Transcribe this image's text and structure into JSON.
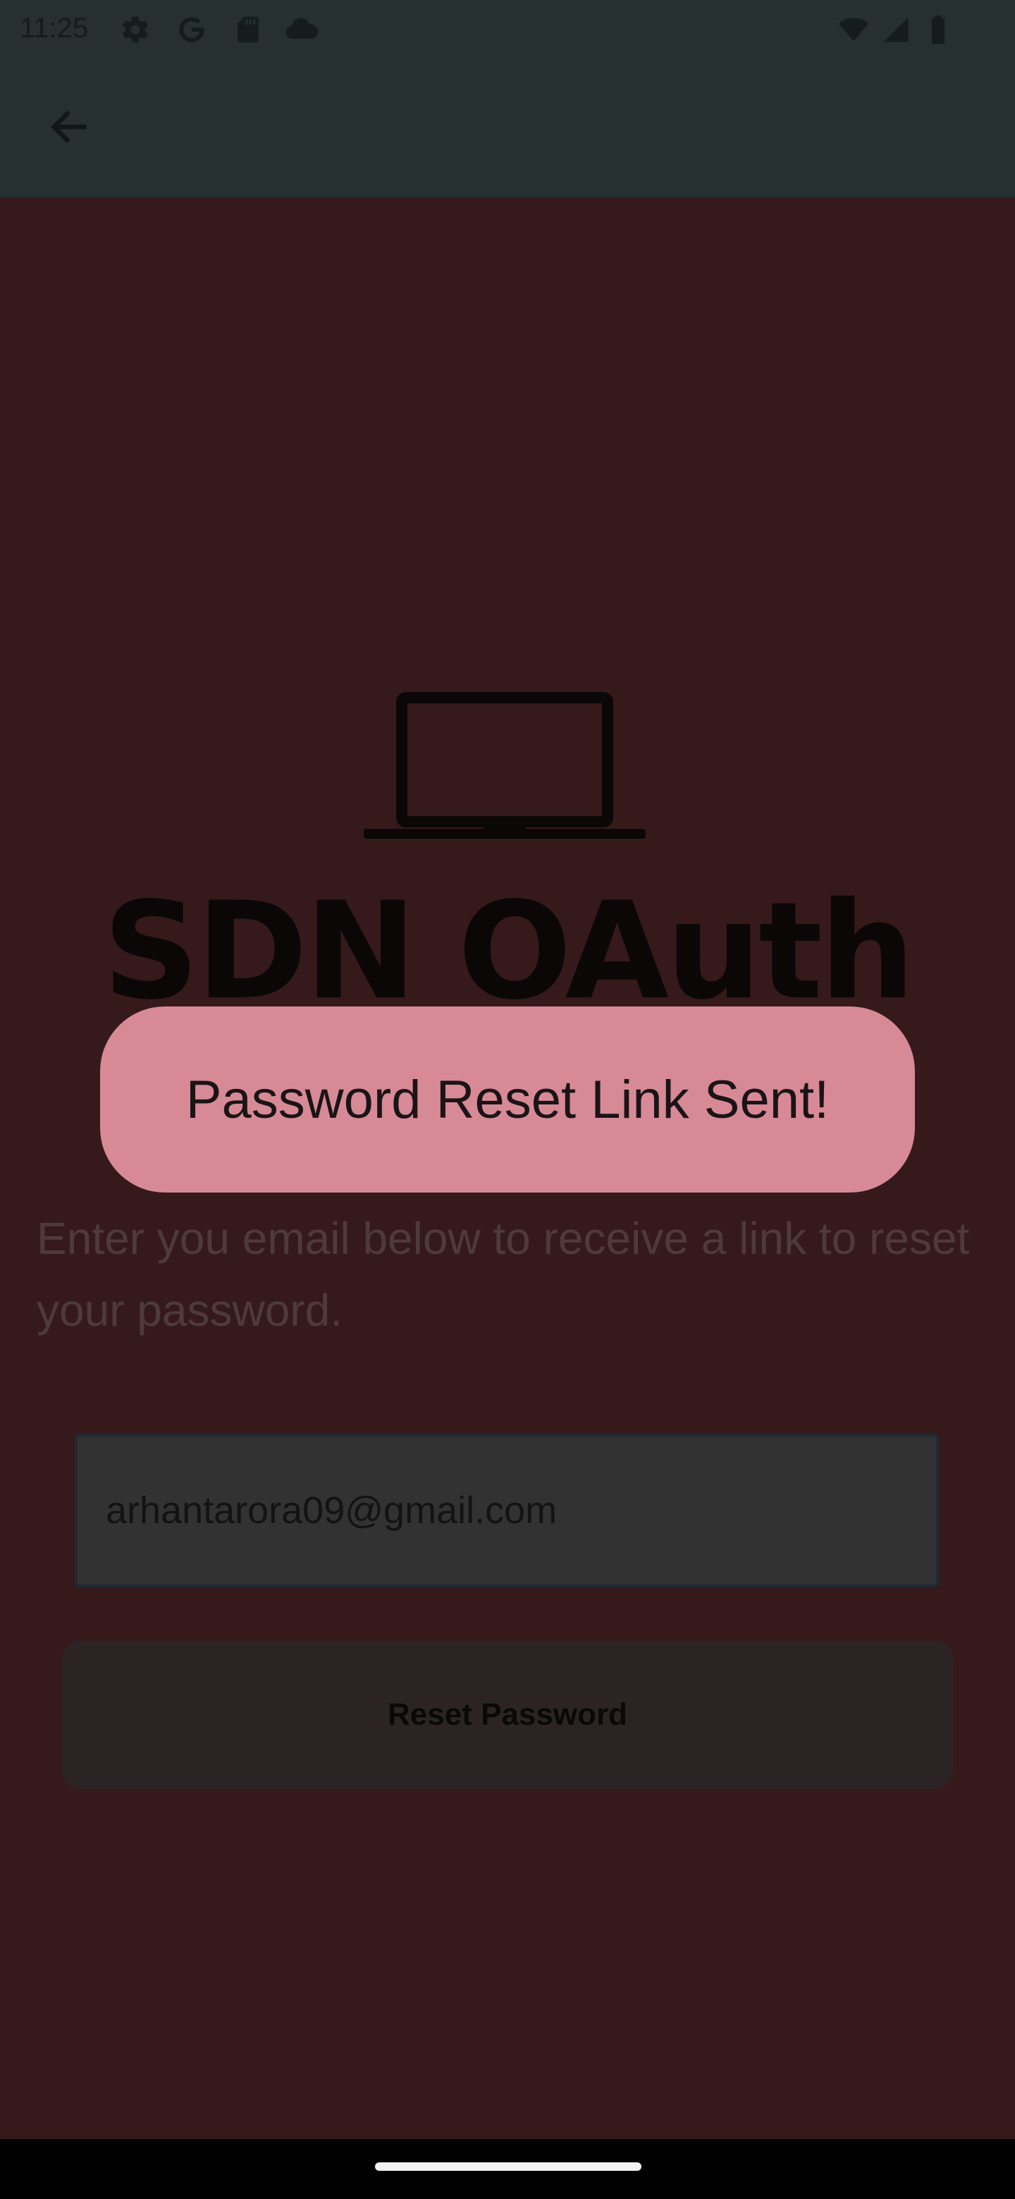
{
  "status_bar": {
    "time": "11:25",
    "left_icons": [
      "gear-icon",
      "google-icon",
      "sd-card-icon",
      "cloud-icon"
    ],
    "right_icons": [
      "wifi-icon",
      "signal-icon",
      "battery-icon"
    ]
  },
  "app_bar": {
    "back_icon": "arrow-left-icon"
  },
  "main": {
    "logo_icon": "laptop-icon",
    "title": "SDN OAuth",
    "instructions": "Enter you email below to receive a link to reset your password.",
    "email_value": "arhantarora09@gmail.com",
    "reset_button_label": "Reset Password"
  },
  "toast": {
    "message": "Password Reset Link Sent!"
  },
  "colors": {
    "background_dim": "#36191b",
    "toast_bg": "#d78a96",
    "app_bar_dim": "#263030"
  }
}
